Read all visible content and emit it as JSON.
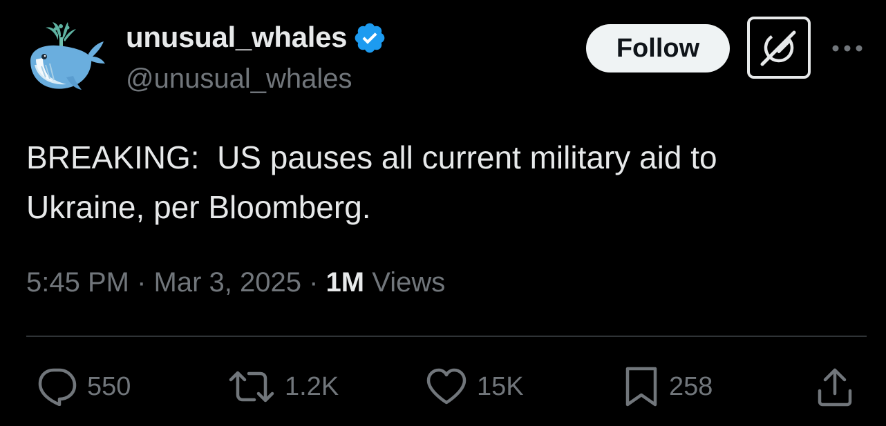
{
  "author": {
    "display_name": "unusual_whales",
    "handle": "@unusual_whales",
    "verified": true,
    "avatar_icon": "whale-avatar-icon",
    "verified_color": "#1d9bf0"
  },
  "header_actions": {
    "follow_label": "Follow",
    "grok_icon": "grok-icon",
    "more_icon": "more-dots-icon"
  },
  "tweet": {
    "text": "BREAKING:  US pauses all current military aid to\nUkraine, per Bloomberg."
  },
  "meta": {
    "time": "5:45 PM",
    "date": "Mar 3, 2025",
    "separator": " · ",
    "views_count": "1M",
    "views_label": "Views"
  },
  "actions": {
    "replies": "550",
    "reposts": "1.2K",
    "likes": "15K",
    "bookmarks": "258"
  },
  "colors": {
    "background": "#000000",
    "text_primary": "#e7e9ea",
    "text_secondary": "#71767b",
    "divider": "#2f3336",
    "follow_bg": "#eff3f4"
  }
}
